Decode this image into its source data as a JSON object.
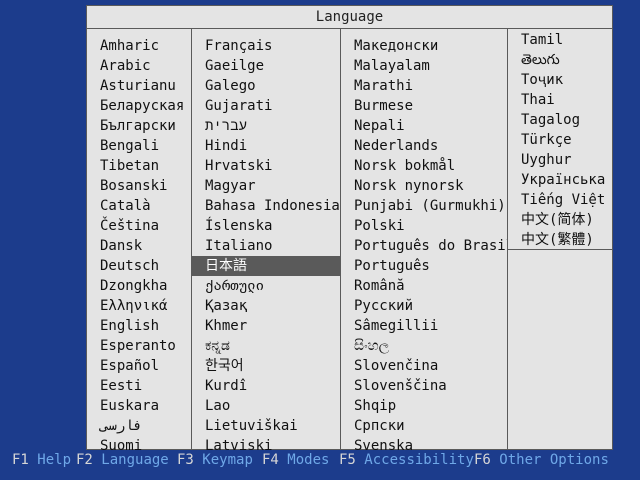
{
  "menu": {
    "title": "Language",
    "columns": [
      [
        "Amharic",
        "Arabic",
        "Asturianu",
        "Беларуская",
        "Български",
        "Bengali",
        "Tibetan",
        "Bosanski",
        "Català",
        "Čeština",
        "Dansk",
        "Deutsch",
        "Dzongkha",
        "Ελληνικά",
        "English",
        "Esperanto",
        "Español",
        "Eesti",
        "Euskara",
        "فارسی",
        "Suomi"
      ],
      [
        "Français",
        "Gaeilge",
        "Galego",
        "Gujarati",
        "עברית",
        "Hindi",
        "Hrvatski",
        "Magyar",
        "Bahasa Indonesia",
        "Íslenska",
        "Italiano",
        "日本語",
        "ქართული",
        "Қазақ",
        "Khmer",
        "ಕನ್ನಡ",
        "한국어",
        "Kurdî",
        "Lao",
        "Lietuviškai",
        "Latviski"
      ],
      [
        "Македонски",
        "Malayalam",
        "Marathi",
        "Burmese",
        "Nepali",
        "Nederlands",
        "Norsk bokmål",
        "Norsk nynorsk",
        "Punjabi (Gurmukhi)",
        "Polski",
        "Português do Brasil",
        "Português",
        "Română",
        "Русский",
        "Sâmegillii",
        "සිංහල",
        "Slovenčina",
        "Slovenščina",
        "Shqip",
        "Српски",
        "Svenska"
      ],
      [
        "Tamil",
        "తెలుగు",
        "Тоҷик",
        "Thai",
        "Tagalog",
        "Türkçe",
        "Uyghur",
        "Українська",
        "Tiếng Việt",
        "中文(简体)",
        "中文(繁體)"
      ]
    ],
    "selected": "日本語"
  },
  "footer": {
    "keys": [
      {
        "key": "F1",
        "label": "Help"
      },
      {
        "key": "F2",
        "label": "Language"
      },
      {
        "key": "F3",
        "label": "Keymap"
      },
      {
        "key": "F4",
        "label": "Modes"
      },
      {
        "key": "F5",
        "label": "Accessibility"
      },
      {
        "key": "F6",
        "label": "Other Options"
      }
    ]
  },
  "colors": {
    "background": "#1c3c8c",
    "menu_bg": "#e4e4e4",
    "selected_bg": "#5a5a5a",
    "footer_label": "#6fa8e8"
  }
}
